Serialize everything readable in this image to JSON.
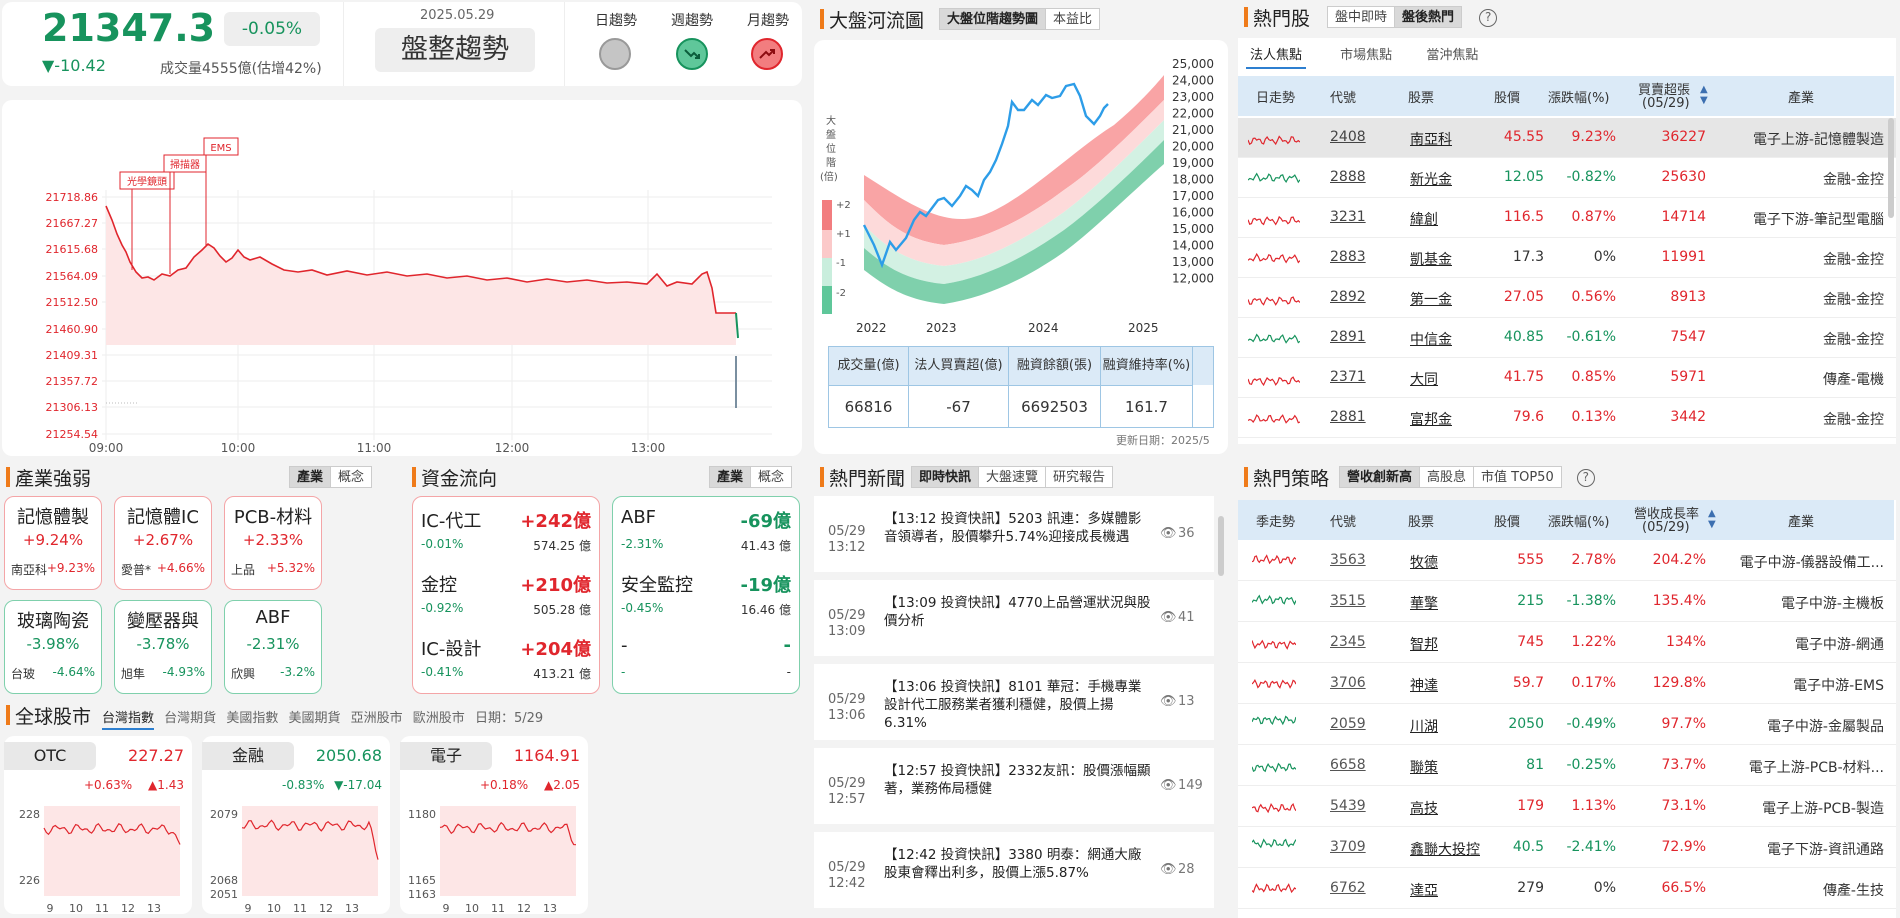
{
  "index": {
    "value": "21347.3",
    "pct": "-0.05%",
    "change": "▼-10.42",
    "volume": "成交量4555億(估增42%)",
    "date": "2025.05.29",
    "trend": "盤整趨勢"
  },
  "trends": [
    {
      "label": "日趨勢",
      "icon": "flat-circle-icon",
      "color": "#bbbbbb"
    },
    {
      "label": "週趨勢",
      "icon": "down-trend-icon",
      "color": "#17935d"
    },
    {
      "label": "月趨勢",
      "icon": "up-trend-icon",
      "color": "#e0262d"
    }
  ],
  "intraday": {
    "yticks": [
      "21718.86",
      "21667.27",
      "21615.68",
      "21564.09",
      "21512.50",
      "21460.90",
      "21409.31",
      "21357.72",
      "21306.13",
      "21254.54"
    ],
    "xticks": [
      "09:00",
      "10:00",
      "11:00",
      "12:00",
      "13:00"
    ],
    "annotations": [
      "光學鏡頭",
      "掃描器",
      "EMS"
    ]
  },
  "river": {
    "title": "大盤河流圖",
    "tabs": [
      "大盤位階趨勢圖",
      "本益比"
    ],
    "ylabel": "大盤位階(倍)",
    "bands": [
      "+2",
      "+1",
      "-1",
      "-2"
    ],
    "yticks": [
      "25,000",
      "24,000",
      "23,000",
      "22,000",
      "21,000",
      "20,000",
      "19,000",
      "18,000",
      "17,000",
      "16,000",
      "15,000",
      "14,000",
      "13,000",
      "12,000"
    ],
    "xticks": [
      "2022",
      "2023",
      "2024",
      "2025"
    ],
    "table": {
      "headers": [
        "成交量(億)",
        "法人買賣超(億)",
        "融資餘額(張)",
        "融資維持率(%)"
      ],
      "values": [
        "66816",
        "-67",
        "6692503",
        "161.7"
      ]
    },
    "updated": "更新日期：2025/5"
  },
  "hot": {
    "title": "熱門股",
    "tabs": [
      "盤中即時",
      "盤後熱門"
    ],
    "subtabs": [
      "法人焦點",
      "市場焦點",
      "當沖焦點"
    ],
    "headers": [
      "日走勢",
      "代號",
      "股票",
      "股價",
      "漲跌幅(%)",
      "買賣超張",
      "(05/29)",
      "產業"
    ],
    "rows": [
      {
        "code": "2408",
        "name": "南亞科",
        "price": "45.55",
        "pct": "9.23%",
        "vol": "36227",
        "ind": "電子上游-記憶體製造",
        "c": "up"
      },
      {
        "code": "2888",
        "name": "新光金",
        "price": "12.05",
        "pct": "-0.82%",
        "vol": "25630",
        "ind": "金融-金控",
        "c": "dn"
      },
      {
        "code": "3231",
        "name": "緯創",
        "price": "116.5",
        "pct": "0.87%",
        "vol": "14714",
        "ind": "電子下游-筆記型電腦",
        "c": "up"
      },
      {
        "code": "2883",
        "name": "凱基金",
        "price": "17.3",
        "pct": "0%",
        "vol": "11991",
        "ind": "金融-金控",
        "c": "fl"
      },
      {
        "code": "2892",
        "name": "第一金",
        "price": "27.05",
        "pct": "0.56%",
        "vol": "8913",
        "ind": "金融-金控",
        "c": "up"
      },
      {
        "code": "2891",
        "name": "中信金",
        "price": "40.85",
        "pct": "-0.61%",
        "vol": "7547",
        "ind": "金融-金控",
        "c": "dn"
      },
      {
        "code": "2371",
        "name": "大同",
        "price": "41.75",
        "pct": "0.85%",
        "vol": "5971",
        "ind": "傳產-電機",
        "c": "up"
      },
      {
        "code": "2881",
        "name": "富邦金",
        "price": "79.6",
        "pct": "0.13%",
        "vol": "3442",
        "ind": "金融-金控",
        "c": "up"
      }
    ]
  },
  "industry": {
    "title": "產業強弱",
    "tabs": [
      "產業",
      "概念"
    ],
    "items": [
      {
        "name": "記憶體製",
        "pct": "+9.24%",
        "stock": "南亞科",
        "spct": "+9.23%",
        "c": "up"
      },
      {
        "name": "記憶體IC",
        "pct": "+2.67%",
        "stock": "愛普*",
        "spct": "+4.66%",
        "c": "up"
      },
      {
        "name": "PCB-材料",
        "pct": "+2.33%",
        "stock": "上品",
        "spct": "+5.32%",
        "c": "up"
      },
      {
        "name": "玻璃陶瓷",
        "pct": "-3.98%",
        "stock": "台玻",
        "spct": "-4.64%",
        "c": "dn"
      },
      {
        "name": "變壓器與",
        "pct": "-3.78%",
        "stock": "旭隼",
        "spct": "-4.93%",
        "c": "dn"
      },
      {
        "name": "ABF",
        "pct": "-2.31%",
        "stock": "欣興",
        "spct": "-3.2%",
        "c": "dn"
      }
    ]
  },
  "flow": {
    "title": "資金流向",
    "tabs": [
      "產業",
      "概念"
    ],
    "left": [
      {
        "name": "IC-代工",
        "amt": "+242億",
        "pct": "-0.01%",
        "val": "574.25 億"
      },
      {
        "name": "金控",
        "amt": "+210億",
        "pct": "-0.92%",
        "val": "505.28 億"
      },
      {
        "name": "IC-設計",
        "amt": "+204億",
        "pct": "-0.41%",
        "val": "413.21 億"
      }
    ],
    "right": [
      {
        "name": "ABF",
        "amt": "-69億",
        "pct": "-2.31%",
        "val": "41.43 億"
      },
      {
        "name": "安全監控",
        "amt": "-19億",
        "pct": "-0.45%",
        "val": "16.46 億"
      },
      {
        "name": "-",
        "amt": "-",
        "pct": "-",
        "val": "-"
      }
    ]
  },
  "global": {
    "title": "全球股市",
    "tabs": [
      "台灣指數",
      "台灣期貨",
      "美國指數",
      "美國期貨",
      "亞洲股市",
      "歐洲股市"
    ],
    "date": "日期：5/29",
    "cards": [
      {
        "name": "OTC",
        "val": "227.27",
        "pct": "+0.63%",
        "chg": "▲1.43",
        "c": "up",
        "yt": [
          "228",
          "226"
        ],
        "xt": [
          "9",
          "10",
          "11",
          "12",
          "13"
        ]
      },
      {
        "name": "金融",
        "val": "2050.68",
        "pct": "-0.83%",
        "chg": "▼-17.04",
        "c": "dn",
        "yt": [
          "2079",
          "2068",
          "2051"
        ],
        "xt": [
          "9",
          "10",
          "11",
          "12",
          "13"
        ]
      },
      {
        "name": "電子",
        "val": "1164.91",
        "pct": "+0.18%",
        "chg": "▲2.05",
        "c": "up",
        "yt": [
          "1180",
          "1165",
          "1163"
        ],
        "xt": [
          "9",
          "10",
          "11",
          "12",
          "13"
        ]
      }
    ]
  },
  "news": {
    "title": "熱門新聞",
    "tabs": [
      "即時快訊",
      "大盤速覽",
      "研究報告"
    ],
    "items": [
      {
        "date": "05/29",
        "time": "13:12",
        "text": "【13:12 投資快訊】5203 訊連：多媒體影音領導者，股價攀升5.74%迎接成長機遇",
        "views": "36"
      },
      {
        "date": "05/29",
        "time": "13:09",
        "text": "【13:09 投資快訊】4770上品營運狀況與股價分析",
        "views": "41"
      },
      {
        "date": "05/29",
        "time": "13:06",
        "text": "【13:06 投資快訊】8101 華冠：手機專業設計代工服務業者獲利穩健，股價上揚6.31%",
        "views": "13"
      },
      {
        "date": "05/29",
        "time": "12:57",
        "text": "【12:57 投資快訊】2332友訊：股價漲幅顯著，業務佈局穩健",
        "views": "149"
      },
      {
        "date": "05/29",
        "time": "12:42",
        "text": "【12:42 投資快訊】3380 明泰：網通大廠股東會釋出利多，股價上漲5.87%",
        "views": "28"
      }
    ]
  },
  "strategy": {
    "title": "熱門策略",
    "tabs": [
      "營收創新高",
      "高股息",
      "市值 TOP50"
    ],
    "headers": [
      "季走勢",
      "代號",
      "股票",
      "股價",
      "漲跌幅(%)",
      "營收成長率",
      "(05/29)",
      "產業"
    ],
    "rows": [
      {
        "code": "3563",
        "name": "牧德",
        "price": "555",
        "pct": "2.78%",
        "g": "204.2%",
        "ind": "電子中游-儀器設備工...",
        "c": "up"
      },
      {
        "code": "3515",
        "name": "華擎",
        "price": "215",
        "pct": "-1.38%",
        "g": "135.4%",
        "ind": "電子中游-主機板",
        "c": "dn"
      },
      {
        "code": "2345",
        "name": "智邦",
        "price": "745",
        "pct": "1.22%",
        "g": "134%",
        "ind": "電子中游-網通",
        "c": "up"
      },
      {
        "code": "3706",
        "name": "神達",
        "price": "59.7",
        "pct": "0.17%",
        "g": "129.8%",
        "ind": "電子中游-EMS",
        "c": "up"
      },
      {
        "code": "2059",
        "name": "川湖",
        "price": "2050",
        "pct": "-0.49%",
        "g": "97.7%",
        "ind": "電子中游-金屬製品",
        "c": "dn"
      },
      {
        "code": "6658",
        "name": "聯策",
        "price": "81",
        "pct": "-0.25%",
        "g": "73.7%",
        "ind": "電子上游-PCB-材料...",
        "c": "dn"
      },
      {
        "code": "5439",
        "name": "高技",
        "price": "179",
        "pct": "1.13%",
        "g": "73.1%",
        "ind": "電子上游-PCB-製造",
        "c": "up"
      },
      {
        "code": "3709",
        "name": "鑫聯大投控",
        "price": "40.5",
        "pct": "-2.41%",
        "g": "72.9%",
        "ind": "電子下游-資訊通路",
        "c": "dn"
      },
      {
        "code": "6762",
        "name": "達亞",
        "price": "279",
        "pct": "0%",
        "g": "66.5%",
        "ind": "傳產-生技",
        "c": "fl"
      }
    ]
  }
}
